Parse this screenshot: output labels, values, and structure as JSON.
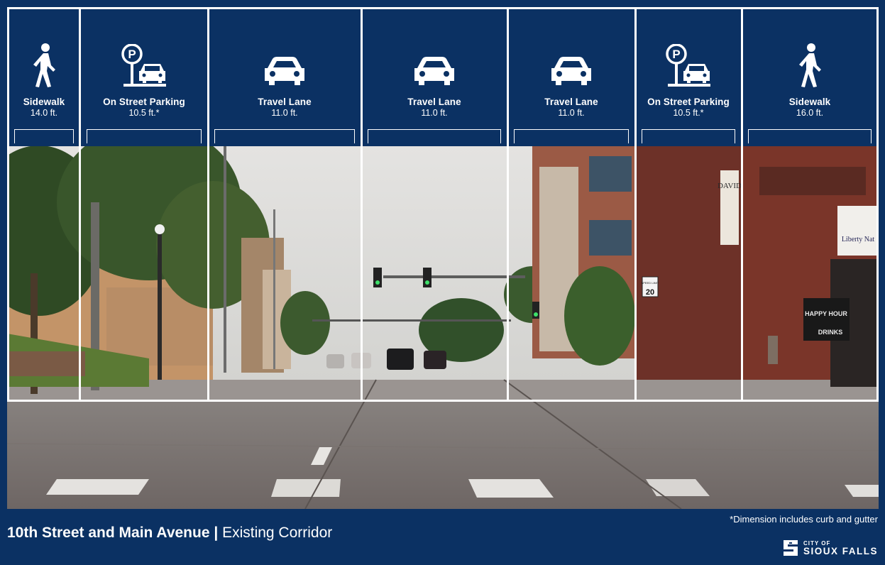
{
  "panels": [
    {
      "id": "sidewalk-left",
      "label": "Sidewalk",
      "dimension": "14.0 ft.",
      "icon": "pedestrian-icon"
    },
    {
      "id": "parking-left",
      "label": "On Street Parking",
      "dimension": "10.5 ft.*",
      "icon": "parking-icon"
    },
    {
      "id": "travel-lane-1",
      "label": "Travel Lane",
      "dimension": "11.0 ft.",
      "icon": "car-icon"
    },
    {
      "id": "travel-lane-2",
      "label": "Travel Lane",
      "dimension": "11.0 ft.",
      "icon": "car-icon"
    },
    {
      "id": "travel-lane-3",
      "label": "Travel Lane",
      "dimension": "11.0 ft.",
      "icon": "car-icon"
    },
    {
      "id": "parking-right",
      "label": "On Street Parking",
      "dimension": "10.5 ft.*",
      "icon": "parking-icon"
    },
    {
      "id": "sidewalk-right",
      "label": "Sidewalk",
      "dimension": "16.0 ft.",
      "icon": "pedestrian-icon"
    }
  ],
  "photo": {
    "signs": {
      "david": "DAVID",
      "liberty": "Liberty Nat",
      "happy_hour": "HAPPY HOUR",
      "drinks": "DRINKS",
      "speed_limit": "SPEED LIMIT",
      "speed_value": "20"
    }
  },
  "footer": {
    "title_bold": "10th Street and Main Avenue",
    "separator": " | ",
    "title_light": "Existing Corridor",
    "footnote": "*Dimension includes curb and gutter",
    "logo_top": "CITY OF",
    "logo_name": "SIOUX FALLS"
  },
  "colors": {
    "navy": "#0b3163",
    "white": "#ffffff"
  }
}
